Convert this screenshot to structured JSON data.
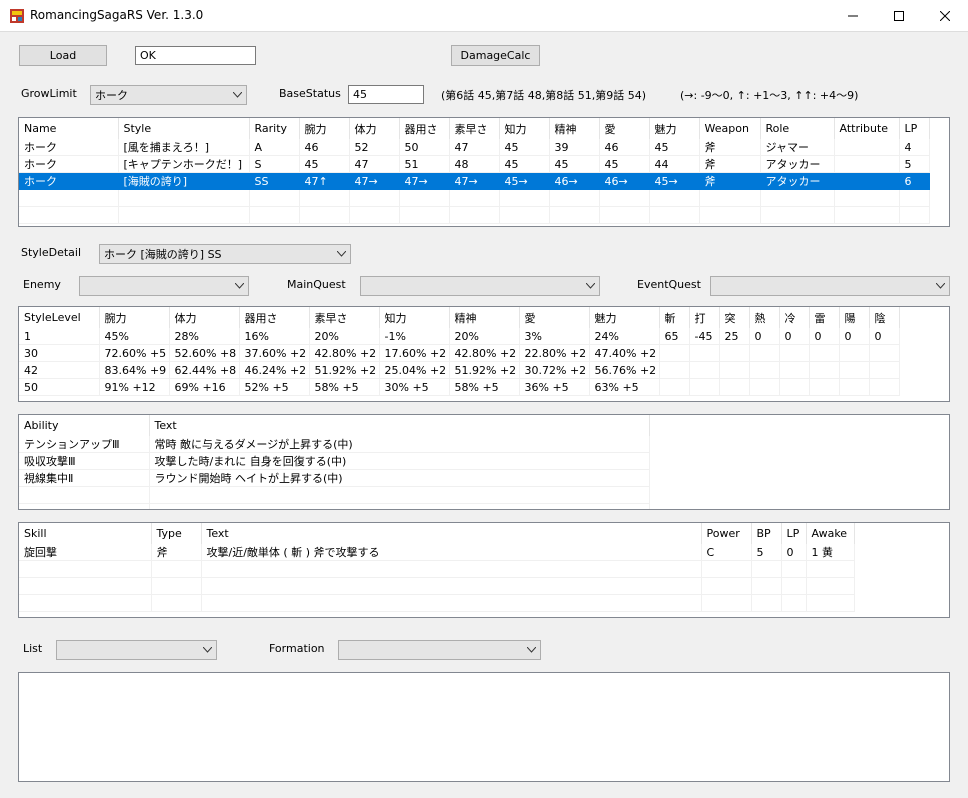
{
  "window": {
    "title": "RomancingSagaRS  Ver. 1.3.0"
  },
  "toolbar": {
    "load_label": "Load",
    "status_value": "OK",
    "damagecalc_label": "DamageCalc"
  },
  "growlimit": {
    "label": "GrowLimit",
    "value": "ホーク"
  },
  "basestatus": {
    "label": "BaseStatus",
    "value": "45",
    "note": "(第6話 45,第7話 48,第8話 51,第9話 54)",
    "legend": "(→: -9～0, ↑: +1～3, ↑↑: +4～9)"
  },
  "styles": {
    "headers": [
      "Name",
      "Style",
      "Rarity",
      "腕力",
      "体力",
      "器用さ",
      "素早さ",
      "知力",
      "精神",
      "愛",
      "魅力",
      "Weapon",
      "Role",
      "Attribute",
      "LP"
    ],
    "rows": [
      [
        "ホーク",
        "[風を捕まえろ！]",
        "A",
        "46",
        "52",
        "50",
        "47",
        "45",
        "39",
        "46",
        "45",
        "斧",
        "ジャマー",
        "",
        "4"
      ],
      [
        "ホーク",
        "[キャプテンホークだ！]",
        "S",
        "45",
        "47",
        "51",
        "48",
        "45",
        "45",
        "45",
        "44",
        "斧",
        "アタッカー",
        "",
        "5"
      ],
      [
        "ホーク",
        "[海賊の誇り]",
        "SS",
        "47↑",
        "47→",
        "47→",
        "47→",
        "45→",
        "46→",
        "46→",
        "45→",
        "斧",
        "アタッカー",
        "",
        "6"
      ]
    ],
    "selected_row": 2
  },
  "styledetail": {
    "label": "StyleDetail",
    "value": "ホーク [海賊の誇り] SS"
  },
  "filters": {
    "enemy_label": "Enemy",
    "enemy_value": "",
    "mainquest_label": "MainQuest",
    "mainquest_value": "",
    "eventquest_label": "EventQuest",
    "eventquest_value": ""
  },
  "levels": {
    "headers": [
      "StyleLevel",
      "腕力",
      "体力",
      "器用さ",
      "素早さ",
      "知力",
      "精神",
      "愛",
      "魅力",
      "斬",
      "打",
      "突",
      "熱",
      "冷",
      "雷",
      "陽",
      "陰"
    ],
    "rows": [
      [
        "1",
        "45%",
        "28%",
        "16%",
        "20%",
        "-1%",
        "20%",
        "3%",
        "24%",
        "65",
        "-45",
        "25",
        "0",
        "0",
        "0",
        "0",
        "0"
      ],
      [
        "30",
        "72.60% +5",
        "52.60% +8",
        "37.60% +2",
        "42.80% +2",
        "17.60% +2",
        "42.80% +2",
        "22.80% +2",
        "47.40% +2",
        "",
        "",
        "",
        "",
        "",
        "",
        "",
        ""
      ],
      [
        "42",
        "83.64% +9",
        "62.44% +8",
        "46.24% +2",
        "51.92% +2",
        "25.04% +2",
        "51.92% +2",
        "30.72% +2",
        "56.76% +2",
        "",
        "",
        "",
        "",
        "",
        "",
        "",
        ""
      ],
      [
        "50",
        "91% +12",
        "69% +16",
        "52% +5",
        "58% +5",
        "30% +5",
        "58% +5",
        "36% +5",
        "63% +5",
        "",
        "",
        "",
        "",
        "",
        "",
        "",
        ""
      ]
    ]
  },
  "abilities": {
    "headers": [
      "Ability",
      "Text"
    ],
    "rows": [
      [
        "テンションアップⅢ",
        "常時  敵に与えるダメージが上昇する(中)"
      ],
      [
        "吸収攻撃Ⅲ",
        "攻撃した時/まれに  自身を回復する(中)"
      ],
      [
        "視線集中Ⅱ",
        "ラウンド開始時  ヘイトが上昇する(中)"
      ]
    ]
  },
  "skills": {
    "headers": [
      "Skill",
      "Type",
      "Text",
      "Power",
      "BP",
      "LP",
      "Awake"
    ],
    "rows": [
      [
        "旋回撃",
        "斧",
        "攻撃/近/敵単体 ( 斬 ) 斧で攻撃する",
        "C",
        "5",
        "0",
        "1 黄"
      ]
    ]
  },
  "bottom": {
    "list_label": "List",
    "list_value": "",
    "formation_label": "Formation",
    "formation_value": ""
  }
}
